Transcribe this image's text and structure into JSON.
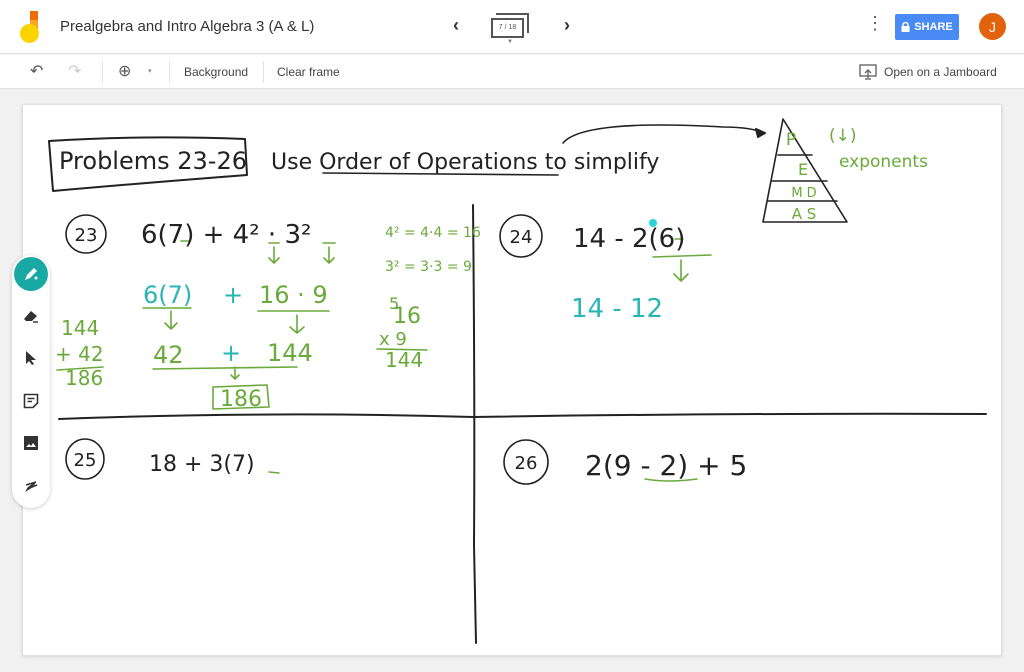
{
  "app": {
    "title": "Prealgebra and Intro Algebra 3 (A & L)",
    "frame_indicator": "7 / 18",
    "share_label": "SHARE",
    "avatar_initial": "J",
    "more_label": "⋮",
    "prev_label": "‹",
    "next_label": "›"
  },
  "toolbar": {
    "undo": "↶",
    "redo": "↷",
    "zoom": "⊕",
    "zoom_caret": "▾",
    "background_label": "Background",
    "clear_frame_label": "Clear frame",
    "open_jamboard_label": "Open on a Jamboard"
  },
  "tools": [
    "pen",
    "eraser",
    "select",
    "sticky-note",
    "image",
    "laser"
  ],
  "colors": {
    "black_ink": "#222222",
    "green_ink": "#6aaa3a",
    "teal_ink": "#2ab5b5",
    "share_blue": "#4a8af4",
    "avatar_orange": "#e2620d",
    "active_tool": "#19a9a4"
  },
  "board": {
    "header_box": "Problems 23-26",
    "instruction": "Use Order of Operations to simplify",
    "pemdas": {
      "rows": [
        "P",
        "E",
        "M D",
        "A S"
      ],
      "note_1": "(↓)",
      "note_2": "exponents"
    },
    "p23": {
      "number": "23",
      "expression": "6(7) + 4² · 3²",
      "side_1": "4² = 4·4 = 16",
      "side_2": "3² = 3·3 = 9",
      "step_1_left": "6(7)",
      "step_1_plus": "+",
      "step_1_right": "16 · 9",
      "step_2_left": "42",
      "step_2_plus": "+",
      "step_2_right": "144",
      "answer": "186",
      "add_top": "144",
      "add_mid": "+ 42",
      "add_bottom": "186",
      "carry": "5",
      "mult_top": "16",
      "mult_mid": "x 9",
      "mult_bottom": "144"
    },
    "p24": {
      "number": "24",
      "expression": "14 - 2(6)",
      "step_1": "14 - 12"
    },
    "p25": {
      "number": "25",
      "expression": "18 + 3(7)"
    },
    "p26": {
      "number": "26",
      "expression": "2(9 - 2) + 5"
    }
  }
}
